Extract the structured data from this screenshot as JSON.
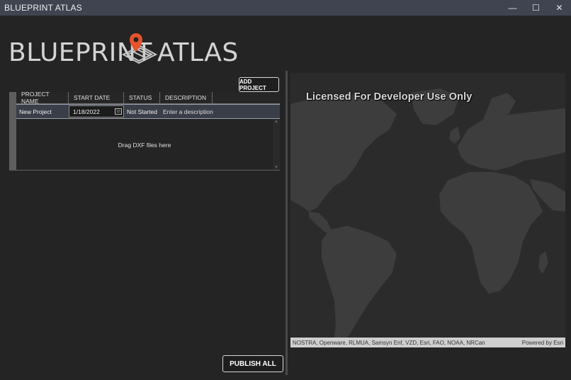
{
  "window": {
    "title": "BLUEPRINT ATLAS",
    "controls": {
      "minimize": "—",
      "maximize": "☐",
      "close": "✕"
    }
  },
  "logo": {
    "left": "BLUEPRINT",
    "right": "ATLAS",
    "pin_color": "#e8532a"
  },
  "actions": {
    "add_project": "ADD PROJECT",
    "publish_all": "PUBLISH ALL"
  },
  "grid": {
    "columns": [
      "PROJECT NAME",
      "START DATE",
      "STATUS",
      "DESCRIPTION"
    ],
    "rows": [
      {
        "name": "New Project",
        "start_date": "1/18/2022",
        "status": "Not Started",
        "description": "Enter a description"
      }
    ],
    "drop_hint": "Drag DXF files here",
    "calendar_glyph": "15"
  },
  "map": {
    "watermark": "Licensed For Developer Use Only",
    "attribution": "NOSTRA, Openware, RLMUA, Samsyn Enf, VZD, Esri, FAO, NOAA, NRCan",
    "powered_by": "Powered by Esri",
    "ocean_color": "#2b2b2b",
    "land_color": "#3d3d3d"
  }
}
